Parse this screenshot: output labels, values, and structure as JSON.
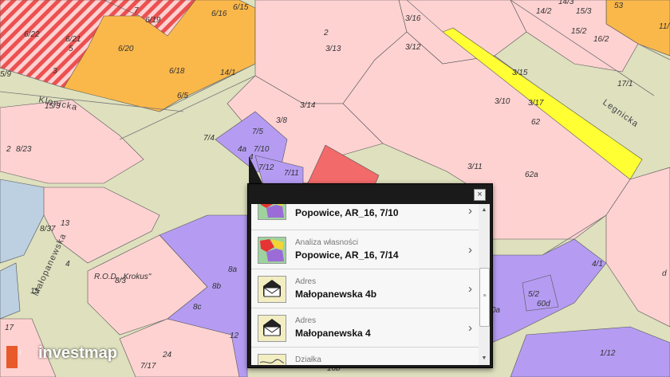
{
  "map": {
    "streets": [
      "Klonicka",
      "Legnicka",
      "Małopanewska"
    ],
    "garden_label": "R.O.D. „Krokus\"",
    "parcel_labels": [
      "7",
      "6/19",
      "6/16",
      "6/15",
      "3/16",
      "14/2",
      "14/3",
      "15/3",
      "53",
      "6/22",
      "6/21",
      "5",
      "2",
      "3/13",
      "3/12",
      "15/2",
      "16/2",
      "11/",
      "3",
      "6/20",
      "6/18",
      "14/1",
      "3/15",
      "17/1",
      "15/3",
      "5/9",
      "6/5",
      "3/14",
      "3/10",
      "3/17",
      "62",
      "3/8",
      "7/5",
      "7/4",
      "2",
      "8/23",
      "7/10",
      "4a",
      "4",
      "7/12",
      "7/11",
      "3/11",
      "62a",
      "13",
      "8/37",
      "4",
      "8/3",
      "15",
      "8a",
      "8b",
      "8c",
      "12",
      "24",
      "7/17",
      "17",
      "4/1",
      "5/2",
      "60d",
      "0a",
      "1/12",
      "16b",
      "d"
    ]
  },
  "popup": {
    "close_label": "×",
    "items": [
      {
        "category": "",
        "name": "Popowice, AR_16, 7/10",
        "icon": "ownership-analysis-icon"
      },
      {
        "category": "Analiza własności",
        "name": "Popowice, AR_16, 7/14",
        "icon": "ownership-analysis-icon"
      },
      {
        "category": "Adres",
        "name": "Małopanewska 4b",
        "icon": "address-envelope-icon"
      },
      {
        "category": "Adres",
        "name": "Małopanewska 4",
        "icon": "address-envelope-icon"
      },
      {
        "category": "Działka",
        "name": "",
        "icon": "parcel-icon"
      }
    ],
    "chevron": "›"
  },
  "brand": {
    "name": "investmap"
  },
  "colors": {
    "residential": "#ffd2d2",
    "commercial": "#fbb84a",
    "public": "#b59cf2",
    "selected": "#f26a6a",
    "street": "#dee0be",
    "water": "#bcd0e2",
    "highlight": "#ffff33"
  }
}
